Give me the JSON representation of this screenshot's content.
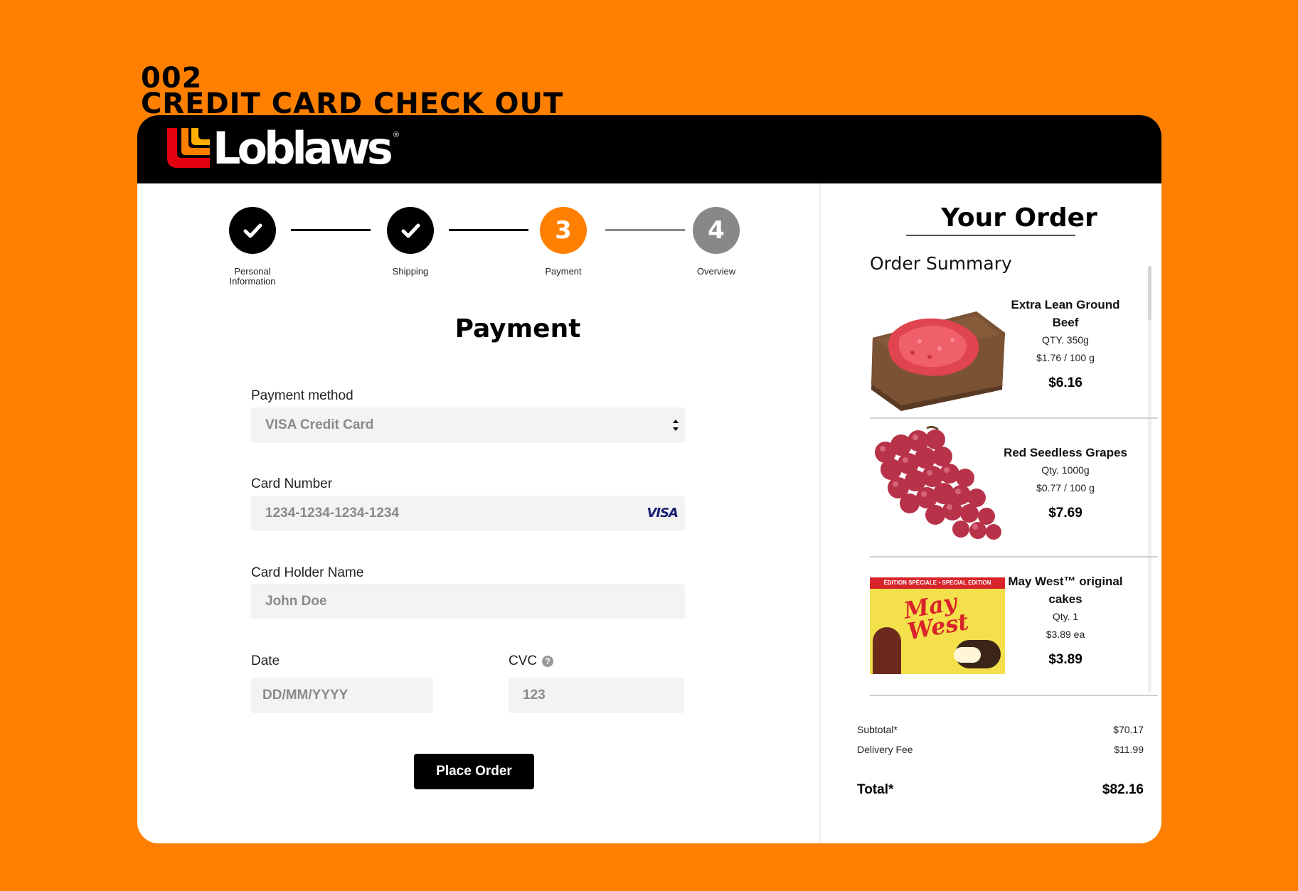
{
  "page_heading": {
    "number": "002",
    "title": "CREDIT CARD CHECK OUT"
  },
  "header": {
    "brand": "Loblaws",
    "registered_mark": "®"
  },
  "stepper": {
    "steps": [
      {
        "label_line1": "Personal",
        "label_line2": "Information",
        "state": "done",
        "number": "1"
      },
      {
        "label_line1": "Shipping",
        "label_line2": "",
        "state": "done",
        "number": "2"
      },
      {
        "label_line1": "Payment",
        "label_line2": "",
        "state": "active",
        "number": "3"
      },
      {
        "label_line1": "Overview",
        "label_line2": "",
        "state": "todo",
        "number": "4"
      }
    ]
  },
  "payment_form": {
    "title": "Payment",
    "payment_method": {
      "label": "Payment method",
      "value": "VISA Credit Card"
    },
    "card_number": {
      "label": "Card Number",
      "placeholder": "1234-1234-1234-1234",
      "brand": "VISA"
    },
    "card_holder": {
      "label": "Card Holder Name",
      "placeholder": "John Doe"
    },
    "date": {
      "label": "Date",
      "placeholder": "DD/MM/YYYY"
    },
    "cvc": {
      "label": "CVC",
      "placeholder": "123",
      "help": "?"
    },
    "submit_label": "Place Order"
  },
  "order": {
    "title": "Your Order",
    "summary_title": "Order Summary",
    "items": [
      {
        "name_line1": "Extra Lean Ground",
        "name_line2": "Beef",
        "qty": "QTY.  350g",
        "unit_price": "$1.76 / 100 g",
        "price": "$6.16",
        "icon": "ground-beef-image"
      },
      {
        "name_line1": "Red Seedless Grapes",
        "name_line2": "",
        "qty": "Qty.  1000g",
        "unit_price": "$0.77 / 100 g",
        "price": "$7.69",
        "icon": "grapes-image"
      },
      {
        "name_line1": "May West™ original",
        "name_line2": "cakes",
        "qty": "Qty. 1",
        "unit_price": "$3.89  ea",
        "price": "$3.89",
        "icon": "may-west-box-image",
        "box_banner": "ÉDITION SPÉCIALE • SPECIAL EDITION",
        "box_brand": "May West"
      }
    ],
    "subtotal": {
      "label": "Subtotal*",
      "value": "$70.17"
    },
    "delivery": {
      "label": "Delivery Fee",
      "value": "$11.99"
    },
    "total": {
      "label": "Total*",
      "value": "$82.16"
    }
  },
  "colors": {
    "accent": "#FF8000",
    "done": "#000000",
    "todo": "#888888",
    "field_bg": "#F3F3F3"
  }
}
